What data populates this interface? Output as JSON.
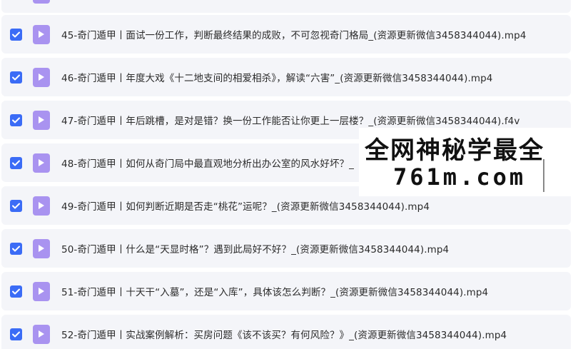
{
  "files": [
    {
      "name": "",
      "checked": true
    },
    {
      "name": "45-奇门遁甲丨面试一份工作，判断最终结果的成败，不可忽视奇门格局_(资源更新微信3458344044).mp4",
      "checked": true
    },
    {
      "name": "46-奇门遁甲丨年度大戏《十二地支间的相爱相杀》，解读“六害”_(资源更新微信3458344044).mp4",
      "checked": true
    },
    {
      "name": "47-奇门遁甲丨年后跳槽，是对是错？换一份工作能否让你更上一层楼？_(资源更新微信3458344044).f4v",
      "checked": true
    },
    {
      "name": "48-奇门遁甲丨如何从奇门局中最直观地分析出办公室的风水好坏？_",
      "checked": true
    },
    {
      "name": "49-奇门遁甲丨如何判断近期是否走“桃花”运呢？_(资源更新微信3458344044).mp4",
      "checked": true
    },
    {
      "name": "50-奇门遁甲丨什么是“天显时格”？遇到此局好不好？_(资源更新微信3458344044).mp4",
      "checked": true
    },
    {
      "name": "51-奇门遁甲丨十天干“入墓”，还是“入库”，具体该怎么判断？_(资源更新微信3458344044).mp4",
      "checked": true
    },
    {
      "name": "52-奇门遁甲丨实战案例解析：买房问题《该不该买？有何风险？》_(资源更新微信3458344044).mp4",
      "checked": true
    }
  ],
  "watermark": {
    "line1": "全网神秘学最全",
    "line2": "761m.com"
  },
  "colors": {
    "checkbox": "#3b6cf6",
    "file_icon": "#a993f0",
    "row_bg": "#f4f5f9"
  },
  "icons": {
    "checkbox": "checkmark-icon",
    "file": "video-play-icon"
  }
}
